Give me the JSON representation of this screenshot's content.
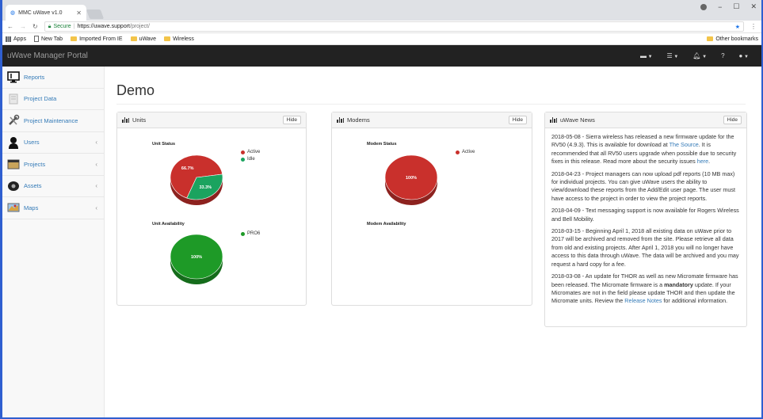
{
  "browser": {
    "tab_title": "MMC uWave v1.0",
    "url_secure_label": "Secure",
    "url_host": "https://uwave.support",
    "url_path": "/project/",
    "bookmarks": [
      "Apps",
      "New Tab",
      "Imported From IE",
      "uWave",
      "Wireless"
    ],
    "other_bookmarks": "Other bookmarks"
  },
  "navbar": {
    "brand": "uWave Manager Portal"
  },
  "sidebar": {
    "items": [
      {
        "label": "Reports",
        "icon": "monitor-icon",
        "arrow": false
      },
      {
        "label": "Project Data",
        "icon": "document-icon",
        "arrow": false
      },
      {
        "label": "Project Maintenance",
        "icon": "wrench-icon",
        "arrow": false
      },
      {
        "label": "Users",
        "icon": "user-icon",
        "arrow": true
      },
      {
        "label": "Projects",
        "icon": "projects-icon",
        "arrow": true
      },
      {
        "label": "Assets",
        "icon": "assets-icon",
        "arrow": true
      },
      {
        "label": "Maps",
        "icon": "map-icon",
        "arrow": true
      }
    ]
  },
  "main": {
    "title": "Demo"
  },
  "colors": {
    "active": "#c9302c",
    "idle": "#1ba35f",
    "pro6": "#1e9a27"
  },
  "panels": {
    "units": {
      "title": "Units",
      "hide_label": "Hide",
      "status_label": "Unit Status",
      "availability_label": "Unit Availability",
      "status_legend": [
        "Active",
        "Idle"
      ],
      "availability_legend": [
        "PRO6"
      ]
    },
    "modems": {
      "title": "Modems",
      "hide_label": "Hide",
      "status_label": "Modem Status",
      "availability_label": "Modem Availability",
      "status_legend": [
        "Active"
      ]
    },
    "news": {
      "title": "uWave News",
      "hide_label": "Hide",
      "n1_text": "2018-05-08 - Sierra wireless has released a new firmware update for the RV50 (4.9.3). This is available for download at ",
      "n1_link": "The Source",
      "n1_text2": ". It is recommended that all RV50 users upgrade when possible due to security fixes in this release. Read more about the security issues ",
      "n1_link2": "here",
      "n1_end": ".",
      "n2": "2018-04-23 - Project managers can now upload pdf reports (10 MB max) for individual projects. You can give uWave users the ability to view/download these reports from the Add/Edit user page. The user must have access to the project in order to view the project reports.",
      "n3": "2018-04-09 - Text messaging support is now available for Rogers Wireless and Bell Mobility.",
      "n4": "2018-03-15 - Beginning April 1, 2018 all existing data on uWave prior to 2017 will be archived and removed from the site. Please retrieve all data from old and existing projects. After April 1, 2018 you will no longer have access to this data through uWave. The data will be archived and you may request a hard copy for a fee.",
      "n5_text": "2018-03-08 - An update for THOR as well as new Micromate firmware has been released. The Micromate firmware is a ",
      "n5_bold": "mandatory",
      "n5_text2": " update. If your Micromates are not in the field please update THOR and then update the Micromate units. Review the ",
      "n5_link": "Release Notes",
      "n5_end": " for additional information."
    }
  },
  "chart_data": [
    {
      "type": "pie",
      "title": "Unit Status",
      "categories": [
        "Active",
        "Idle"
      ],
      "values": [
        66.7,
        33.3
      ],
      "labels": [
        "66.7%",
        "33.3%"
      ]
    },
    {
      "type": "pie",
      "title": "Unit Availability",
      "categories": [
        "PRO6"
      ],
      "values": [
        100
      ],
      "labels": [
        "100%"
      ]
    },
    {
      "type": "pie",
      "title": "Modem Status",
      "categories": [
        "Active"
      ],
      "values": [
        100
      ],
      "labels": [
        "100%"
      ]
    }
  ]
}
